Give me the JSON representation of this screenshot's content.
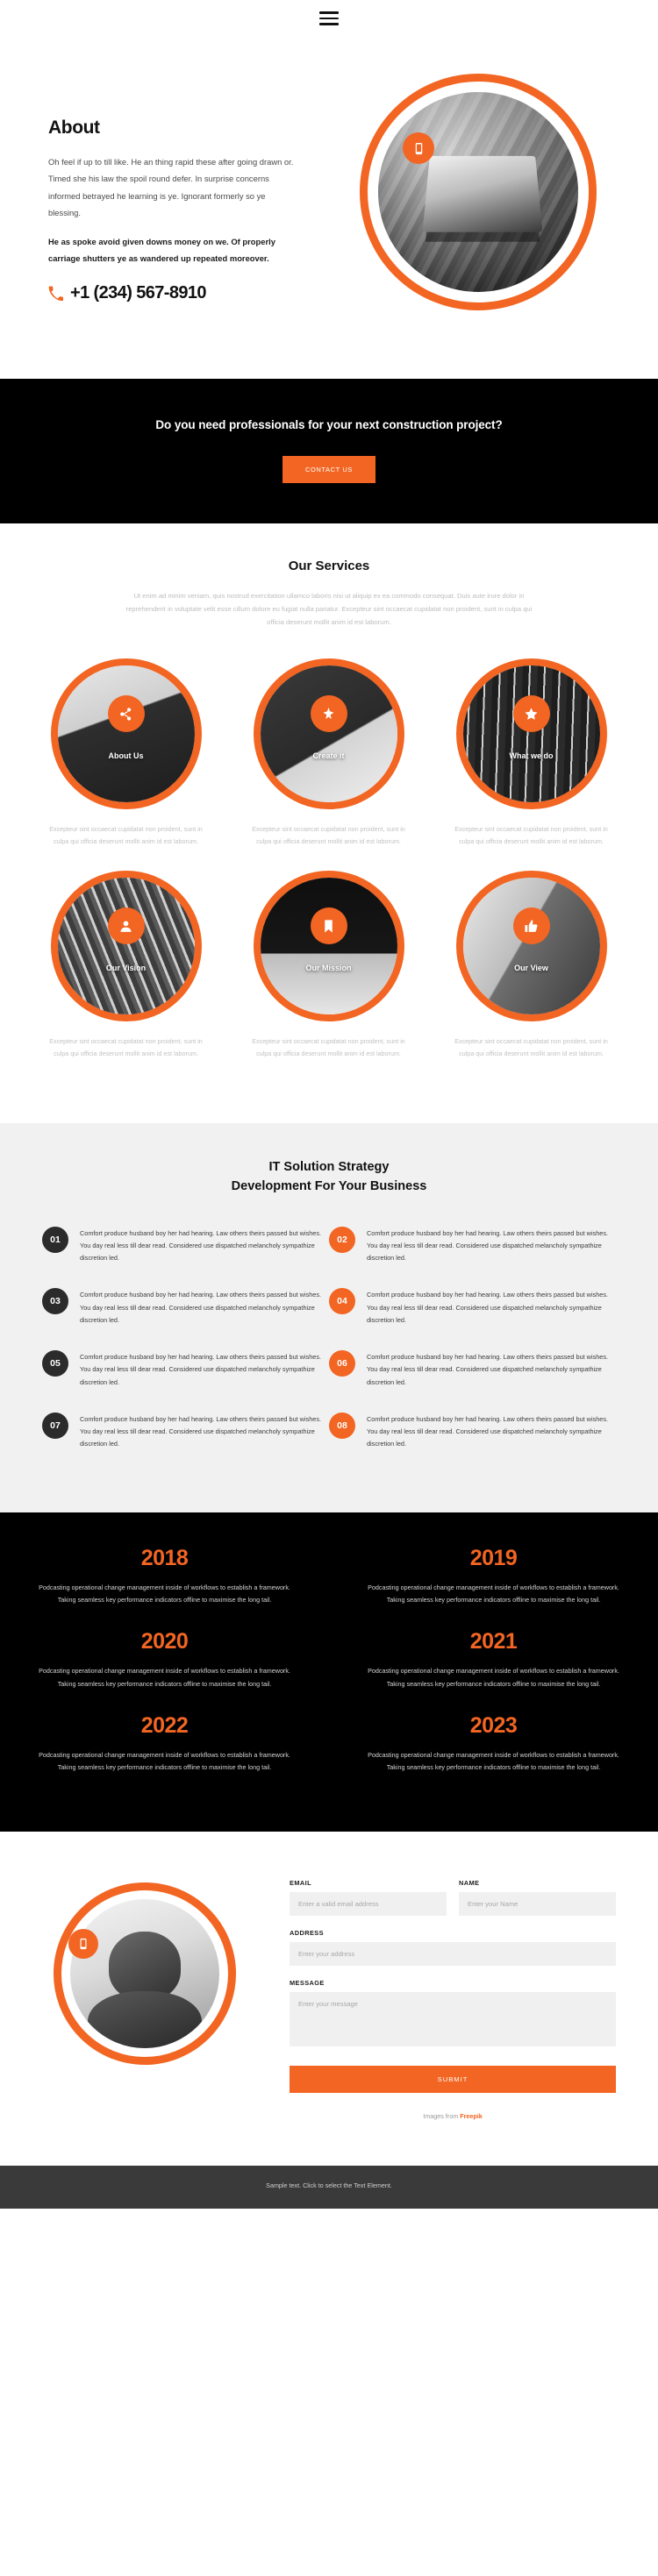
{
  "header": {
    "menu_label": "menu-toggle"
  },
  "about": {
    "title": "About",
    "paragraph": "Oh feel if up to till like. He an thing rapid these after going drawn or. Timed she his law the spoil round defer. In surprise concerns informed betrayed he learning is ye. Ignorant formerly so ye blessing.",
    "paragraph_bold": "He as spoke avoid given downs money on we. Of properly carriage shutters ye as wandered up repeated moreover.",
    "phone": "+1 (234) 567-8910",
    "phone_icon": "phone-icon",
    "badge_icon": "mobile-device-icon"
  },
  "cta": {
    "heading": "Do you need professionals for your next construction project?",
    "button": "CONTACT US"
  },
  "services": {
    "title": "Our Services",
    "subtitle": "Ut enim ad minim veniam, quis nostrud exercitation ullamco laboris nisi ut aliquip ex ea commodo consequat. Duis aute irure dolor in reprehenderit in voluptate velit esse cillum dolore eu fugiat nulla pariatur. Excepteur sint occaecat cupidatat non proident, sunt in culpa qui officia deserunt mollit anim id est laborum.",
    "common_desc": "Excepteur sint occaecat cupidatat non proident, sunt in culpa qui officia deserunt mollit anim id est laborum.",
    "items": [
      {
        "label": "About Us",
        "icon": "share-nodes-icon",
        "desc": "Excepteur sint occaecat cupidatat non proident, sunt in culpa qui officia deserunt mollit anim id est laborum."
      },
      {
        "label": "Create it",
        "icon": "sparkle-icon",
        "desc": "Excepteur sint occaecat cupidatat non proident, sunt in culpa qui officia deserunt mollit anim id est laborum."
      },
      {
        "label": "What we do",
        "icon": "star-icon",
        "desc": "Excepteur sint occaecat cupidatat non proident, sunt in culpa qui officia deserunt mollit anim id est laborum."
      },
      {
        "label": "Our Vision",
        "icon": "user-icon",
        "desc": "Excepteur sint occaecat cupidatat non proident, sunt in culpa qui officia deserunt mollit anim id est laborum."
      },
      {
        "label": "Our Mission",
        "icon": "bookmark-icon",
        "desc": "Excepteur sint occaecat cupidatat non proident, sunt in culpa qui officia deserunt mollit anim id est laborum."
      },
      {
        "label": "Our View",
        "icon": "thumbs-up-icon",
        "desc": "Excepteur sint occaecat cupidatat non proident, sunt in culpa qui officia deserunt mollit anim id est laborum."
      }
    ]
  },
  "strategy": {
    "title": "IT Solution Strategy Development For Your Business",
    "title_line1": "IT Solution Strategy",
    "title_line2": "Development For Your Business",
    "items": [
      {
        "num": "01",
        "text": "Comfort produce husband boy her had hearing. Law others theirs passed but wishes. You day real less till dear read. Considered use dispatched melancholy sympathize discretion led."
      },
      {
        "num": "02",
        "text": "Comfort produce husband boy her had hearing. Law others theirs passed but wishes. You day real less till dear read. Considered use dispatched melancholy sympathize discretion led."
      },
      {
        "num": "03",
        "text": "Comfort produce husband boy her had hearing. Law others theirs passed but wishes. You day real less till dear read. Considered use dispatched melancholy sympathize discretion led."
      },
      {
        "num": "04",
        "text": "Comfort produce husband boy her had hearing. Law others theirs passed but wishes. You day real less till dear read. Considered use dispatched melancholy sympathize discretion led."
      },
      {
        "num": "05",
        "text": "Comfort produce husband boy her had hearing. Law others theirs passed but wishes. You day real less till dear read. Considered use dispatched melancholy sympathize discretion led."
      },
      {
        "num": "06",
        "text": "Comfort produce husband boy her had hearing. Law others theirs passed but wishes. You day real less till dear read. Considered use dispatched melancholy sympathize discretion led."
      },
      {
        "num": "07",
        "text": "Comfort produce husband boy her had hearing. Law others theirs passed but wishes. You day real less till dear read. Considered use dispatched melancholy sympathize discretion led."
      },
      {
        "num": "08",
        "text": "Comfort produce husband boy her had hearing. Law others theirs passed but wishes. You day real less till dear read. Considered use dispatched melancholy sympathize discretion led."
      }
    ]
  },
  "years": {
    "items": [
      {
        "year": "2018",
        "text": "Podcasting operational change management inside of workflows to establish a framework. Taking seamless key performance indicators offline to maximise the long tail."
      },
      {
        "year": "2019",
        "text": "Podcasting operational change management inside of workflows to establish a framework. Taking seamless key performance indicators offline to maximise the long tail."
      },
      {
        "year": "2020",
        "text": "Podcasting operational change management inside of workflows to establish a framework. Taking seamless key performance indicators offline to maximise the long tail."
      },
      {
        "year": "2021",
        "text": "Podcasting operational change management inside of workflows to establish a framework. Taking seamless key performance indicators offline to maximise the long tail."
      },
      {
        "year": "2022",
        "text": "Podcasting operational change management inside of workflows to establish a framework. Taking seamless key performance indicators offline to maximise the long tail."
      },
      {
        "year": "2023",
        "text": "Podcasting operational change management inside of workflows to establish a framework. Taking seamless key performance indicators offline to maximise the long tail."
      }
    ]
  },
  "contact": {
    "badge_icon": "mobile-device-icon",
    "email_label": "EMAIL",
    "email_placeholder": "Enter a valid email address",
    "name_label": "NAME",
    "name_placeholder": "Enter your Name",
    "address_label": "ADDRESS",
    "address_placeholder": "Enter your address",
    "message_label": "MESSAGE",
    "message_placeholder": "Enter your message",
    "submit_label": "SUBMIT",
    "credit_prefix": "Images from ",
    "credit_link": "Freepik"
  },
  "footer": {
    "text": "Sample text. Click to select the Text Element."
  },
  "colors": {
    "accent": "#f26522",
    "dark": "#000000",
    "panel": "#f1f1f1",
    "footer": "#3a3a3a"
  }
}
